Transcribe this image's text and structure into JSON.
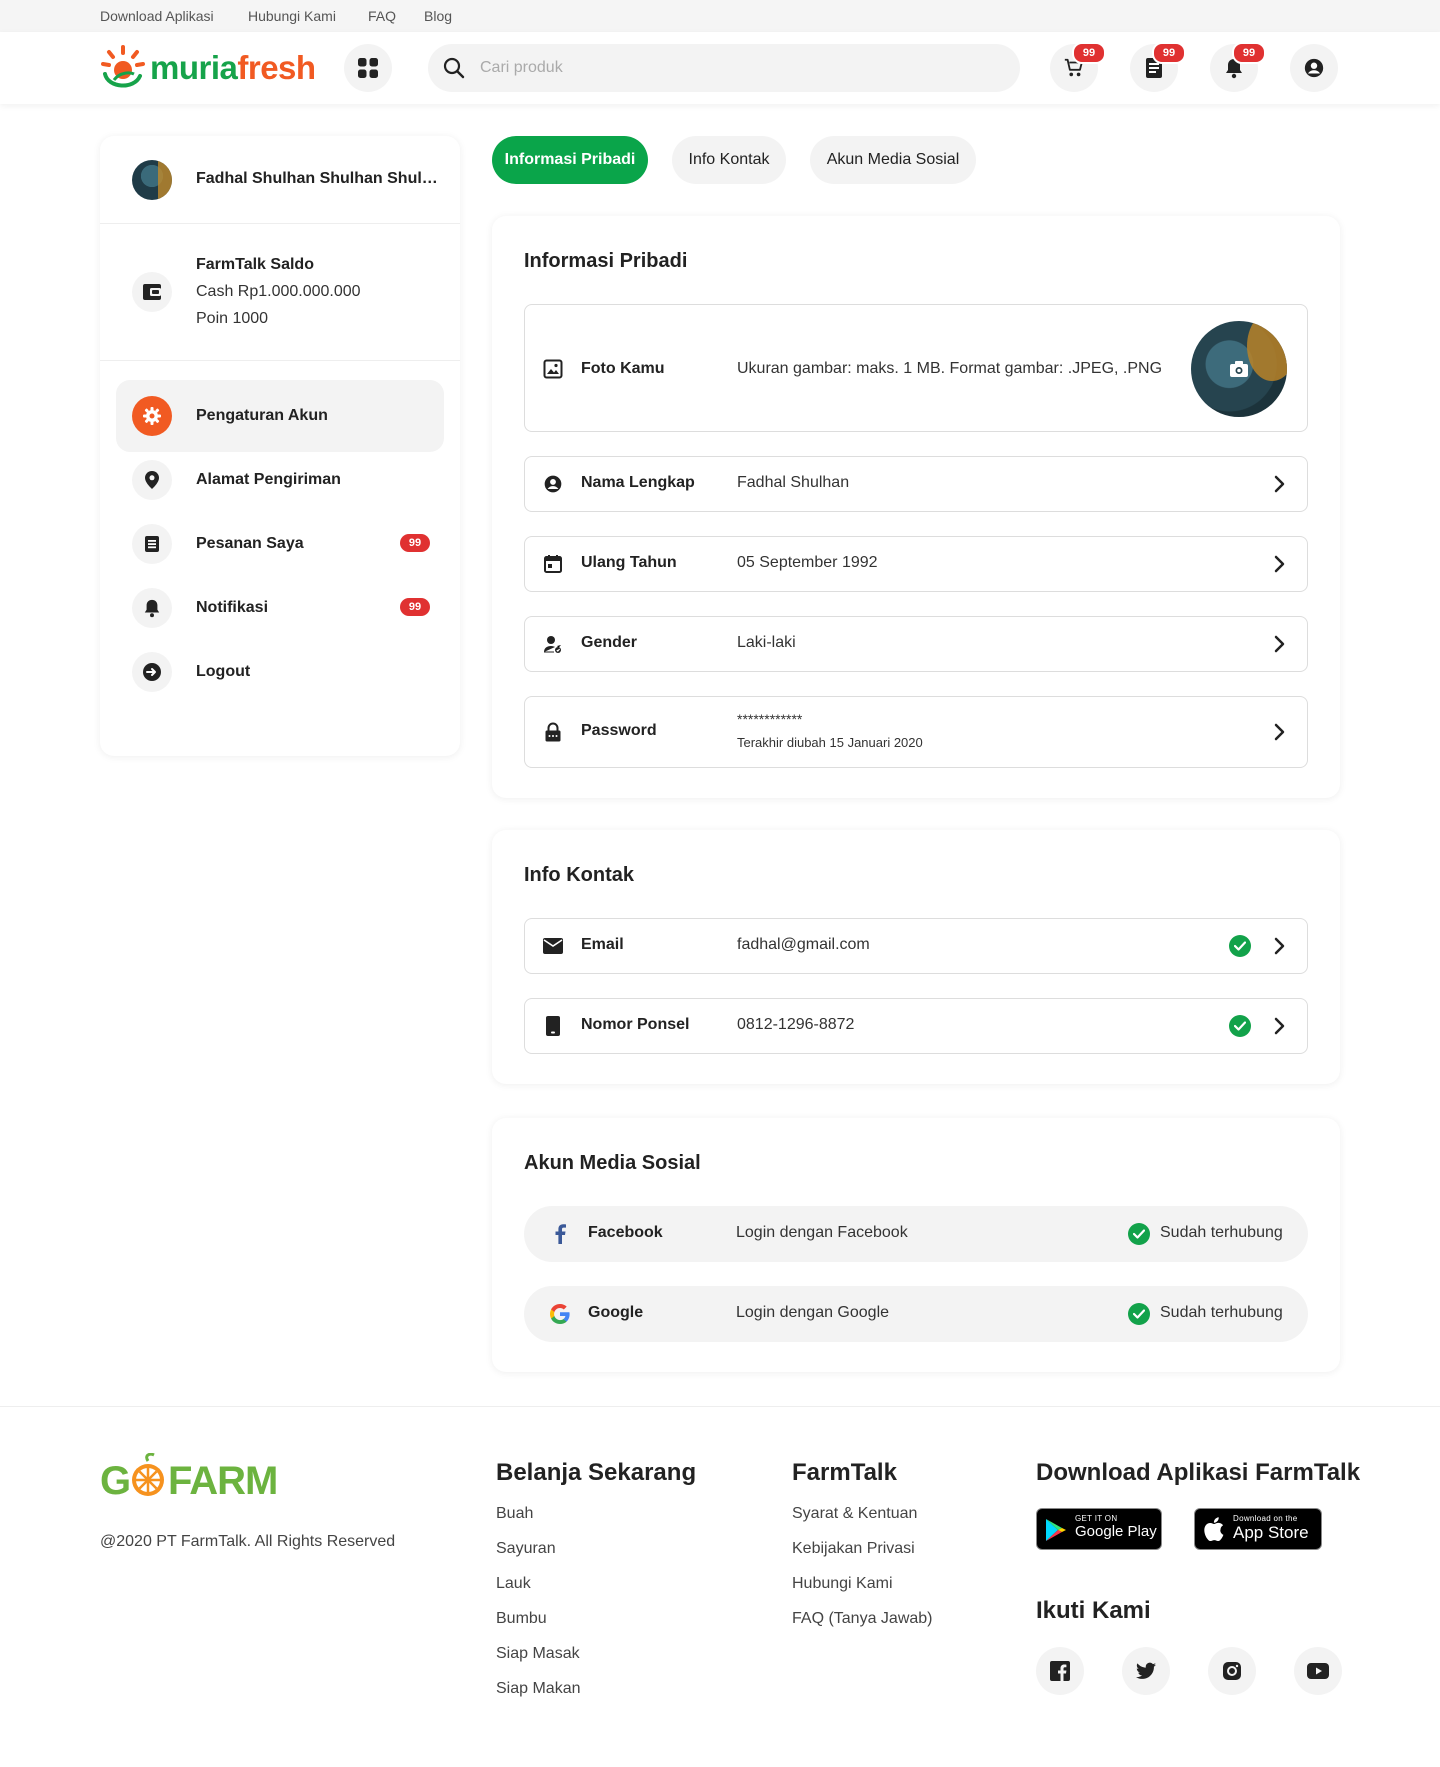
{
  "topbar": {
    "links": [
      "Download Aplikasi",
      "Hubungi Kami",
      "FAQ",
      "Blog"
    ]
  },
  "header": {
    "logo_part1": "muria",
    "logo_part2": "fresh",
    "search_placeholder": "Cari produk",
    "cart_badge": "99",
    "orders_badge": "99",
    "notif_badge": "99"
  },
  "sidebar": {
    "user_name": "Fadhal Shulhan Shulhan Shulhan",
    "saldo_title": "FarmTalk Saldo",
    "saldo_cash": "Cash Rp1.000.000.000",
    "saldo_poin": "Poin 1000",
    "menu": [
      {
        "label": "Pengaturan Akun",
        "icon": "gear-icon"
      },
      {
        "label": "Alamat Pengiriman",
        "icon": "location-pin-icon"
      },
      {
        "label": "Pesanan Saya",
        "icon": "document-icon",
        "badge": "99"
      },
      {
        "label": "Notifikasi",
        "icon": "bell-icon",
        "badge": "99"
      },
      {
        "label": "Logout",
        "icon": "logout-icon"
      }
    ]
  },
  "tabs": [
    "Informasi Pribadi",
    "Info Kontak",
    "Akun Media Sosial"
  ],
  "personal": {
    "title": "Informasi Pribadi",
    "photo_label": "Foto Kamu",
    "photo_hint": "Ukuran gambar: maks. 1 MB. Format gambar: .JPEG, .PNG",
    "rows": [
      {
        "label": "Nama Lengkap",
        "value": "Fadhal Shulhan"
      },
      {
        "label": "Ulang Tahun",
        "value": "05 September 1992"
      },
      {
        "label": "Gender",
        "value": "Laki-laki"
      }
    ],
    "password_label": "Password",
    "password_value": "************",
    "password_sub": "Terakhir diubah 15 Januari 2020"
  },
  "contact": {
    "title": "Info Kontak",
    "rows": [
      {
        "label": "Email",
        "value": "fadhal@gmail.com"
      },
      {
        "label": "Nomor Ponsel",
        "value": "0812-1296-8872"
      }
    ]
  },
  "social": {
    "title": "Akun Media Sosial",
    "rows": [
      {
        "label": "Facebook",
        "value": "Login dengan Facebook",
        "status": "Sudah terhubung"
      },
      {
        "label": "Google",
        "value": "Login dengan Google",
        "status": "Sudah terhubung"
      }
    ]
  },
  "footer": {
    "copyright": "@2020 PT FarmTalk. All Rights Reserved",
    "belanja_title": "Belanja Sekarang",
    "belanja_links": [
      "Buah",
      "Sayuran",
      "Lauk",
      "Bumbu",
      "Siap Masak",
      "Siap Makan"
    ],
    "farmtalk_title": "FarmTalk",
    "farmtalk_links": [
      "Syarat & Kentuan",
      "Kebijakan Privasi",
      "Hubungi Kami",
      "FAQ (Tanya Jawab)"
    ],
    "download_title": "Download Aplikasi FarmTalk",
    "gp_small": "GET IT ON",
    "gp_big": "Google Play",
    "as_small": "Download on the",
    "as_big": "App Store",
    "follow_title": "Ikuti Kami",
    "gofarm_left": "G",
    "gofarm_right": "FARM"
  },
  "colors": {
    "brand_green": "#0aa54a",
    "brand_orange": "#f15a22",
    "badge_red": "#e03131",
    "check_green": "#12a24a"
  }
}
